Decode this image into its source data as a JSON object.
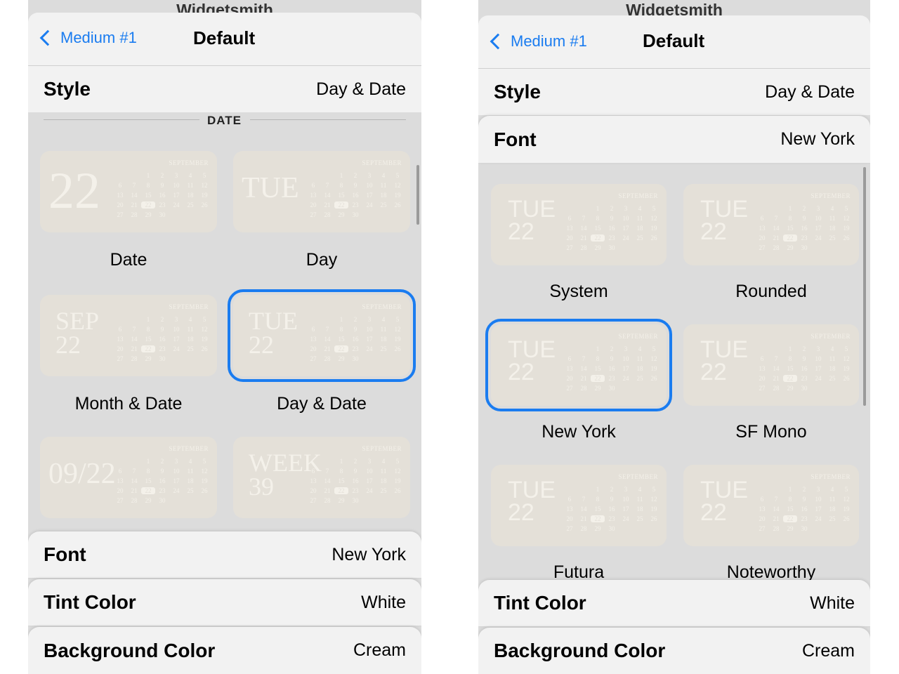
{
  "app_title": "Widgetsmith",
  "header": {
    "back_label": "Medium #1",
    "title": "Default"
  },
  "calendar": {
    "month": "SEPTEMBER",
    "rows": [
      [
        "",
        "",
        "1",
        "2",
        "3",
        "4",
        "5"
      ],
      [
        "6",
        "7",
        "8",
        "9",
        "10",
        "11",
        "12"
      ],
      [
        "13",
        "14",
        "15",
        "16",
        "17",
        "18",
        "19"
      ],
      [
        "20",
        "21",
        "22",
        "23",
        "24",
        "25",
        "26"
      ],
      [
        "27",
        "28",
        "29",
        "30",
        "",
        "",
        ""
      ]
    ],
    "highlight": "22"
  },
  "left": {
    "style_row": {
      "label": "Style",
      "value": "Day & Date"
    },
    "section_label": "DATE",
    "tiles": [
      {
        "line1": "22",
        "line2": "",
        "caption": "Date"
      },
      {
        "line1": "TUE",
        "line2": "",
        "caption": "Day"
      },
      {
        "line1": "SEP",
        "line2": "22",
        "caption": "Month & Date"
      },
      {
        "line1": "TUE",
        "line2": "22",
        "caption": "Day & Date"
      },
      {
        "line1": "09/22",
        "line2": "",
        "caption": ""
      },
      {
        "line1": "WEEK",
        "line2": "39",
        "caption": ""
      }
    ],
    "font_row": {
      "label": "Font",
      "value": "New York"
    },
    "tint_row": {
      "label": "Tint Color",
      "value": "White"
    },
    "bg_row": {
      "label": "Background Color",
      "value": "Cream"
    }
  },
  "right": {
    "style_row": {
      "label": "Style",
      "value": "Day & Date"
    },
    "font_row": {
      "label": "Font",
      "value": "New York"
    },
    "tiles": [
      {
        "line1": "TUE",
        "line2": "22",
        "caption": "System"
      },
      {
        "line1": "TUE",
        "line2": "22",
        "caption": "Rounded"
      },
      {
        "line1": "TUE",
        "line2": "22",
        "caption": "New York"
      },
      {
        "line1": "TUE",
        "line2": "22",
        "caption": "SF Mono"
      },
      {
        "line1": "TUE",
        "line2": "22",
        "caption": "Futura"
      },
      {
        "line1": "TUE",
        "line2": "22",
        "caption": "Noteworthy"
      }
    ],
    "tint_row": {
      "label": "Tint Color",
      "value": "White"
    },
    "bg_row": {
      "label": "Background Color",
      "value": "Cream"
    }
  },
  "colors": {
    "accent": "#1a7cf0",
    "tile": "#e4e0d8",
    "sheet": "#f2f2f2",
    "backdrop": "#dcdcdc"
  }
}
